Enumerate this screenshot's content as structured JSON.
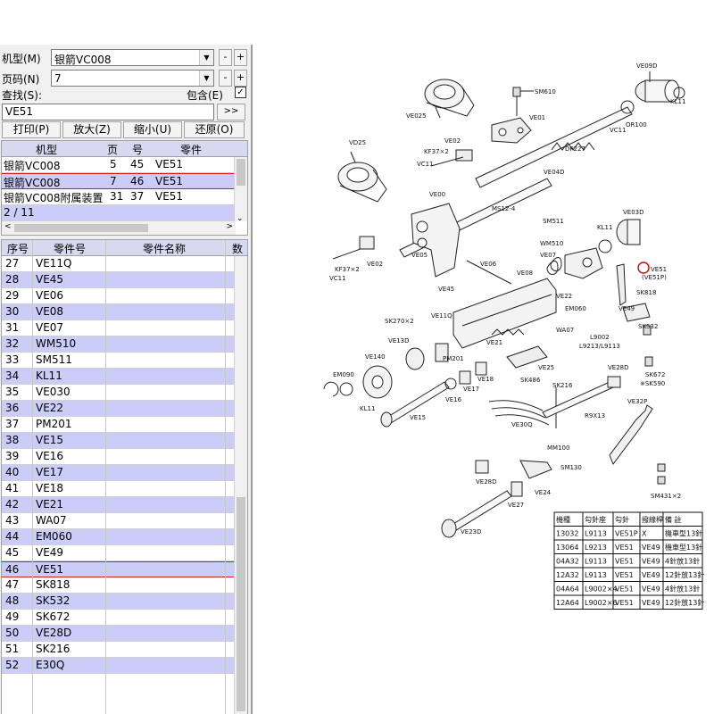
{
  "filter": {
    "model_label": "机型(M)",
    "model_value": "银箭VC008",
    "page_label": "页码(N)",
    "page_value": "7",
    "search_label": "查找(S):",
    "include_label": "包含(E)",
    "include_checked": "✓",
    "search_value": "VE51",
    "search_go": ">>",
    "minus": "-",
    "plus": "+"
  },
  "toolbar": {
    "print": "打印(P)",
    "zoom_in": "放大(Z)",
    "zoom_out": "缩小(U)",
    "restore": "还原(O)"
  },
  "results": {
    "headers": [
      "机型",
      "页",
      "号",
      "零件"
    ],
    "rows": [
      {
        "model": "银箭VC008",
        "page": "5",
        "num": "45",
        "part": "VE51"
      },
      {
        "model": "银箭VC008",
        "page": "7",
        "num": "46",
        "part": "VE51"
      },
      {
        "model": "银箭VC008附属装置",
        "page": "31",
        "num": "37",
        "part": "VE51"
      }
    ],
    "count": "2 / 11"
  },
  "parts": {
    "headers": [
      "序号",
      "零件号",
      "零件名称",
      "数"
    ],
    "rows": [
      {
        "seq": "27",
        "part": "VE11Q"
      },
      {
        "seq": "28",
        "part": "VE45"
      },
      {
        "seq": "29",
        "part": "VE06"
      },
      {
        "seq": "30",
        "part": "VE08"
      },
      {
        "seq": "31",
        "part": "VE07"
      },
      {
        "seq": "32",
        "part": "WM510"
      },
      {
        "seq": "33",
        "part": "SM511"
      },
      {
        "seq": "34",
        "part": "KL11"
      },
      {
        "seq": "35",
        "part": "VE030"
      },
      {
        "seq": "36",
        "part": "VE22"
      },
      {
        "seq": "37",
        "part": "PM201"
      },
      {
        "seq": "38",
        "part": "VE15"
      },
      {
        "seq": "39",
        "part": "VE16"
      },
      {
        "seq": "40",
        "part": "VE17"
      },
      {
        "seq": "41",
        "part": "VE18"
      },
      {
        "seq": "42",
        "part": "VE21"
      },
      {
        "seq": "43",
        "part": "WA07"
      },
      {
        "seq": "44",
        "part": "EM060"
      },
      {
        "seq": "45",
        "part": "VE49"
      },
      {
        "seq": "46",
        "part": "VE51"
      },
      {
        "seq": "47",
        "part": "SK818"
      },
      {
        "seq": "48",
        "part": "SK532"
      },
      {
        "seq": "49",
        "part": "SK672"
      },
      {
        "seq": "50",
        "part": "VE28D"
      },
      {
        "seq": "51",
        "part": "SK216"
      },
      {
        "seq": "52",
        "part": "E30Q"
      }
    ]
  },
  "diagram": {
    "labels": {
      "ve09d": "VE09D",
      "sm610": "SM610",
      "ve01": "VE01",
      "kl11a": "KL11",
      "or100": "OR100",
      "vc11a": "VC11",
      "ve025a": "VE025",
      "ve02a": "VE02",
      "kf37a": "KF37×2",
      "vc11b": "VC11",
      "dp227": "DP227",
      "ve04d": "VE04D",
      "vd25": "VD25",
      "ve00": "VE00",
      "ms12": "MS12-4",
      "ve03d": "VE03D",
      "sm511": "SM511",
      "kl11b": "KL11",
      "wm510": "WM510",
      "ve07": "VE07",
      "ve51": "VE51",
      "ve51p": "(VE51P)",
      "sk818": "SK818",
      "vc11c": "VC11",
      "kf37b": "KF37×2",
      "ve02b": "VE02",
      "ve05": "VE05",
      "ve06": "VE06",
      "ve08": "VE08",
      "ve45": "VE45",
      "ve22": "VE22",
      "em060": "EM060",
      "ve49": "VE49",
      "sk532": "SK532",
      "l9002": "L9002",
      "l9213": "L9213/L9113",
      "sk270": "SK270×2",
      "ve11q": "VE11Q",
      "wa07": "WA07",
      "ve13d": "VE13D",
      "ve21": "VE21",
      "pm201": "PM201",
      "ve140": "VE140",
      "ve25": "VE25",
      "sk672": "SK672",
      "sk590": "※SK590",
      "em090": "EM090",
      "kl11c": "KL11",
      "ve17": "VE17",
      "ve18": "VE18",
      "sk486": "SK486",
      "sk216": "SK216",
      "ve28d": "VE28D",
      "ve16": "VE16",
      "ve15": "VE15",
      "r9x13": "R9X13",
      "ve32p": "VE32P",
      "ve30q": "VE30Q",
      "mm100": "MM100",
      "sm130": "SM130",
      "ve28d2": "VE28D",
      "ve24": "VE24",
      "sm431": "SM431×2",
      "ve27": "VE27",
      "ve23d": "VE23D"
    },
    "table": {
      "headers": [
        "機種",
        "勾針座",
        "勾針",
        "撥線桿",
        "備 註"
      ],
      "rows": [
        [
          "13032",
          "L9113",
          "VE51P",
          "X",
          "機車型13針"
        ],
        [
          "13064",
          "L9213",
          "VE51",
          "VE49",
          "機車型13針"
        ],
        [
          "04A32",
          "L9113",
          "VE51",
          "VE49",
          "4針放13針"
        ],
        [
          "12A32",
          "L9113",
          "VE51",
          "VE49",
          "12針放13針"
        ],
        [
          "04A64",
          "L9002×4",
          "VE51",
          "VE49",
          "4針放13針"
        ],
        [
          "12A64",
          "L9002×6",
          "VE51",
          "VE49",
          "12針放13針"
        ]
      ]
    }
  }
}
